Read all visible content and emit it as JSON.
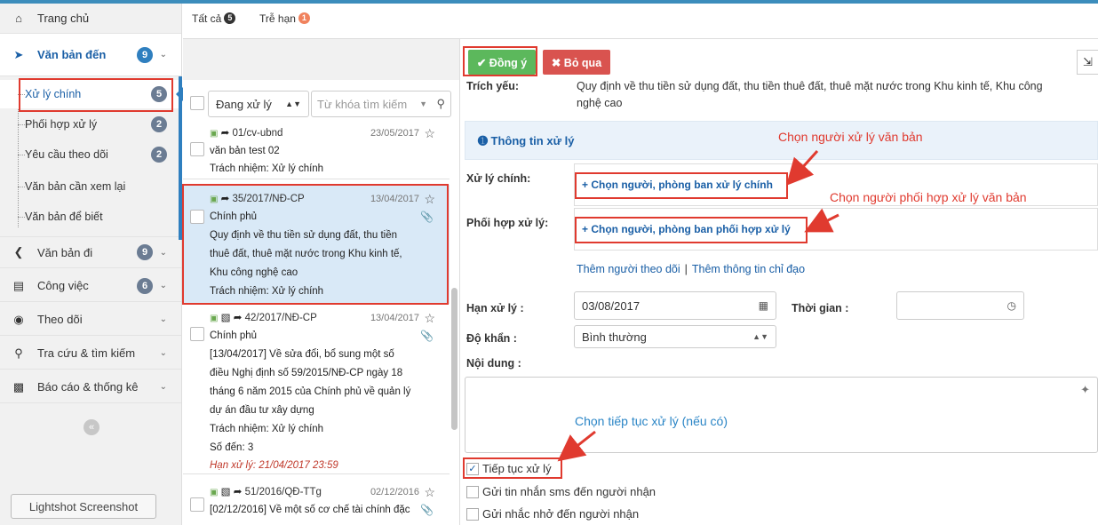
{
  "colors": {
    "accent": "#2f7fbf",
    "ok": "#5cb85c",
    "danger": "#d9534f",
    "annotation": "#e03a2f",
    "overdue_badge": "#f0825d"
  },
  "sidebar": {
    "home": {
      "label": "Trang chủ",
      "icon": "home-icon"
    },
    "incoming": {
      "label": "Văn bản đến",
      "badge": "9",
      "icon": "arrow-circle-right-icon"
    },
    "sub_items": [
      {
        "label": "Xử lý chính",
        "badge": "5"
      },
      {
        "label": "Phối hợp xử lý",
        "badge": "2"
      },
      {
        "label": "Yêu cầu theo dõi",
        "badge": "2"
      },
      {
        "label": "Văn bản cần xem lại",
        "badge": ""
      },
      {
        "label": "Văn bản để biết",
        "badge": ""
      }
    ],
    "outgoing": {
      "label": "Văn bản đi",
      "badge": "9",
      "icon": "arrow-circle-left-icon"
    },
    "tasks": {
      "label": "Công việc",
      "badge": "6",
      "icon": "list-icon"
    },
    "follow": {
      "label": "Theo dõi",
      "icon": "eye-icon"
    },
    "search": {
      "label": "Tra cứu & tìm kiếm",
      "icon": "search-icon"
    },
    "reports": {
      "label": "Báo cáo & thống kê",
      "icon": "bar-chart-icon"
    },
    "collapse": "«",
    "tooltip": "Lightshot Screenshot"
  },
  "tabs": [
    {
      "label": "Tất cả",
      "badge": "5"
    },
    {
      "label": "Trễ hạn",
      "badge": "1"
    }
  ],
  "filter": {
    "status": "Đang xử lý",
    "search_placeholder": "Từ khóa tìm kiếm"
  },
  "list": [
    {
      "code": "01/cv-ubnd",
      "date": "23/05/2017",
      "lines": [
        "văn bản test 02",
        "Trách nhiệm: Xử lý chính"
      ]
    },
    {
      "code": "35/2017/NĐ-CP",
      "date": "13/04/2017",
      "lines": [
        "Chính phủ",
        "Quy định về thu tiền sử dụng đất, thu tiền",
        "thuê đất, thuê mặt nước trong Khu kinh tế,",
        "Khu công nghệ cao",
        "Trách nhiệm: Xử lý chính"
      ]
    },
    {
      "code": "42/2017/NĐ-CP",
      "date": "13/04/2017",
      "lines": [
        "Chính phủ",
        "[13/04/2017] Về sửa đổi, bổ sung một số",
        "điều Nghị định số 59/2015/NĐ-CP ngày 18",
        "tháng 6 năm 2015 của Chính phủ về quản lý",
        "dự án đầu tư xây dựng",
        "Trách nhiệm: Xử lý chính",
        "Số đến: 3"
      ],
      "deadline": "Hạn xử lý: 21/04/2017 23:59"
    },
    {
      "code": "51/2016/QĐ-TTg",
      "date": "02/12/2016",
      "lines": [
        "[02/12/2016] Về một số cơ chế tài chính đặc"
      ]
    }
  ],
  "detail": {
    "btn_ok": "✔ Đồng ý",
    "btn_skip": "✖ Bỏ qua",
    "summary_label": "Trích yếu:",
    "summary_lines": [
      "Quy định về thu tiền sử dụng đất, thu tiền thuê đất, thuê mặt nước trong Khu kinh tế, Khu công",
      "nghệ cao"
    ],
    "info_title": "Thông tin xử lý",
    "main_label": "Xử lý chính:",
    "main_link": "+ Chọn người, phòng ban xử lý chính",
    "coop_label": "Phối hợp xử lý:",
    "coop_link": "+ Chọn người, phòng ban phối hợp xử lý",
    "add_follower": "Thêm người theo dõi",
    "add_direction": "Thêm thông tin chỉ đạo",
    "deadline_label": "Hạn xử lý :",
    "deadline_value": "03/08/2017",
    "time_label": "Thời gian :",
    "urgency_label": "Độ khẩn :",
    "urgency_value": "Bình thường",
    "content_label": "Nội dung :",
    "continue_label": "Tiếp tục xử lý",
    "sms_label": "Gửi tin nhắn sms đến người nhận",
    "remind_label": "Gửi nhắc nhở đến người nhận"
  },
  "annotations": {
    "choose_handler": "Chọn người xử lý văn bản",
    "choose_coop": "Chọn người phối hợp xử lý văn bản",
    "choose_continue": "Chọn tiếp tục xử lý (nếu có)"
  }
}
